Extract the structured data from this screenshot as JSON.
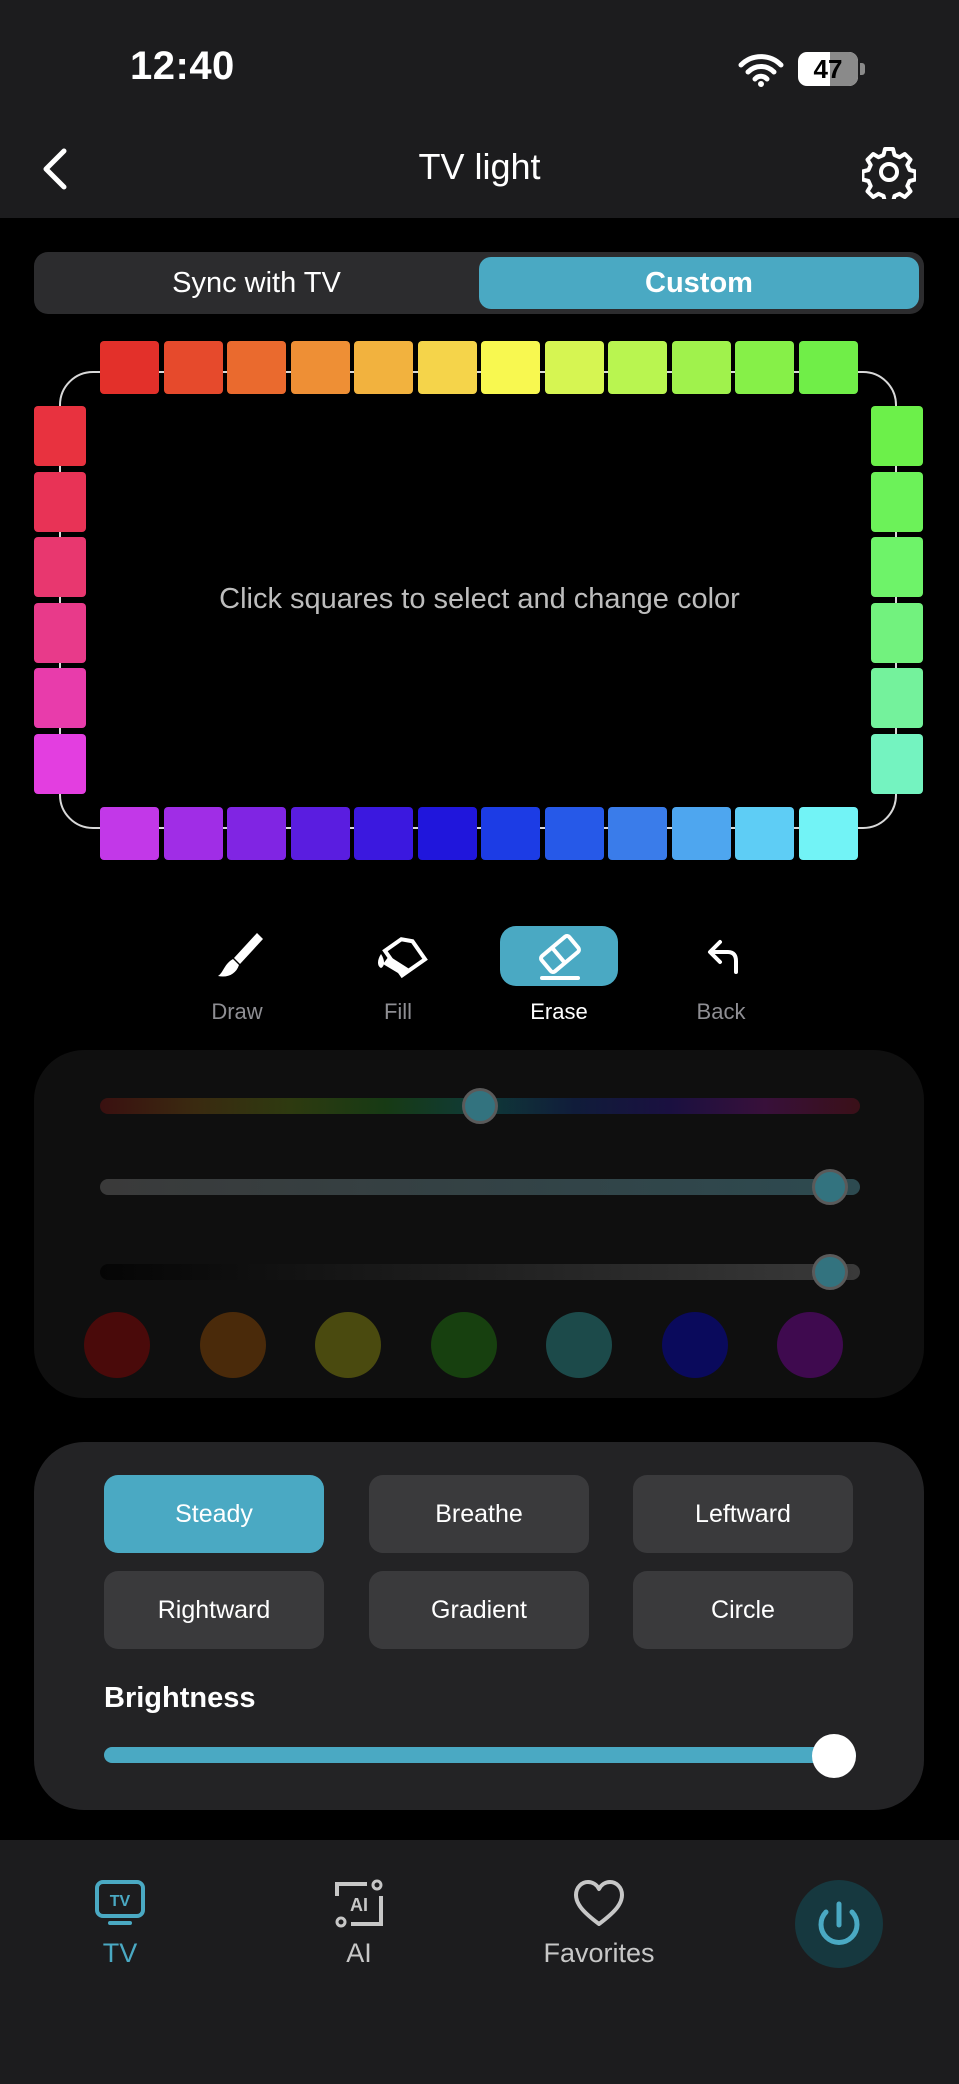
{
  "status_bar": {
    "time": "12:40",
    "battery": "47"
  },
  "header": {
    "title": "TV light",
    "back_icon": "chevron-left-icon",
    "settings_icon": "gear-icon"
  },
  "segment": {
    "options": [
      "Sync with TV",
      "Custom"
    ],
    "selected": "Custom"
  },
  "led_frame": {
    "hint": "Click squares to select and change color",
    "top": [
      "#e3302a",
      "#e64a2c",
      "#ea6a2e",
      "#ee8f35",
      "#f2b23e",
      "#f5d44a",
      "#f8f850",
      "#d6f552",
      "#b9f550",
      "#a0f24c",
      "#86f048",
      "#70ee48"
    ],
    "right": [
      "#6cf04a",
      "#6cf259",
      "#6ef369",
      "#72f27e",
      "#74f29c",
      "#74f3c0"
    ],
    "bottom": [
      "#c238e8",
      "#a02de6",
      "#8025e3",
      "#5a1de0",
      "#3b18df",
      "#2016dc",
      "#1c3ce5",
      "#2659e8",
      "#3a7cea",
      "#4ea6ef",
      "#5ecdf5",
      "#72f3f6"
    ],
    "left": [
      "#e8323f",
      "#e83356",
      "#e8376f",
      "#e83a8a",
      "#e83cab",
      "#e33ee0"
    ]
  },
  "tools": [
    {
      "label": "Draw",
      "icon": "brush-icon",
      "active": false
    },
    {
      "label": "Fill",
      "icon": "paint-bucket-icon",
      "active": false
    },
    {
      "label": "Erase",
      "icon": "eraser-icon",
      "active": true
    },
    {
      "label": "Back",
      "icon": "undo-arrow-icon",
      "active": false
    }
  ],
  "color_controls": {
    "hue_level": 0.5,
    "saturation_level": 1.0,
    "value_level": 1.0,
    "presets": [
      "#4a0a0a",
      "#4a2a0a",
      "#4a4a0f",
      "#17400f",
      "#1c4a4a",
      "#0a0a5c",
      "#3f0a4f"
    ]
  },
  "modes": {
    "options": [
      "Steady",
      "Breathe",
      "Leftward",
      "Rightward",
      "Gradient",
      "Circle"
    ],
    "selected": "Steady"
  },
  "brightness": {
    "label": "Brightness",
    "level": 1.0
  },
  "tabbar": {
    "tabs": [
      {
        "label": "TV",
        "icon": "tv-icon",
        "active": true
      },
      {
        "label": "AI",
        "icon": "ai-icon",
        "active": false
      },
      {
        "label": "Favorites",
        "icon": "heart-icon",
        "active": false
      }
    ],
    "power_icon": "power-icon"
  },
  "colors": {
    "accent": "#4aa9c3",
    "panel": "#232325",
    "bar": "#1c1c1e"
  }
}
